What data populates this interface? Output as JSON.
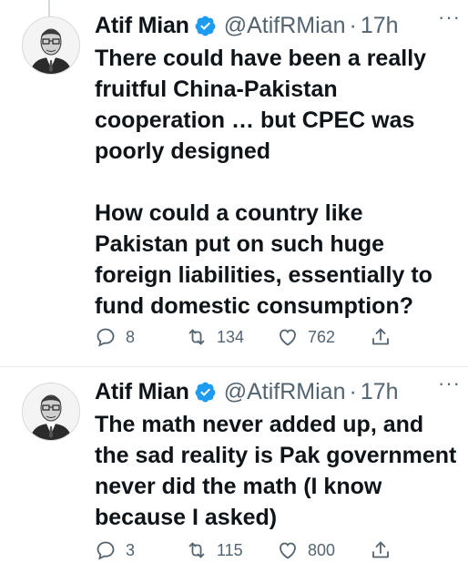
{
  "colors": {
    "verified": "#1d9bf0",
    "secondary_text": "#536471",
    "divider": "#e6ecf0"
  },
  "tweets": [
    {
      "author_name": "Atif Mian",
      "handle": "@AtifRMian",
      "separator": "·",
      "time": "17h",
      "more_label": "···",
      "text": "There could have been a really fruitful China-Pakistan cooperation … but CPEC was poorly designed\n\nHow could a country like Pakistan put on such huge foreign liabilities, essentially to fund domestic consumption?",
      "replies": "8",
      "retweets": "134",
      "likes": "762",
      "icons": {
        "reply": "reply-icon",
        "retweet": "retweet-icon",
        "like": "heart-icon",
        "share": "share-icon",
        "verified": "verified-badge-icon"
      }
    },
    {
      "author_name": "Atif Mian",
      "handle": "@AtifRMian",
      "separator": "·",
      "time": "17h",
      "more_label": "···",
      "text": "The math never added up, and the sad reality is Pak government never did the math (I know because I asked)",
      "replies": "3",
      "retweets": "115",
      "likes": "800",
      "icons": {
        "reply": "reply-icon",
        "retweet": "retweet-icon",
        "like": "heart-icon",
        "share": "share-icon",
        "verified": "verified-badge-icon"
      }
    }
  ]
}
